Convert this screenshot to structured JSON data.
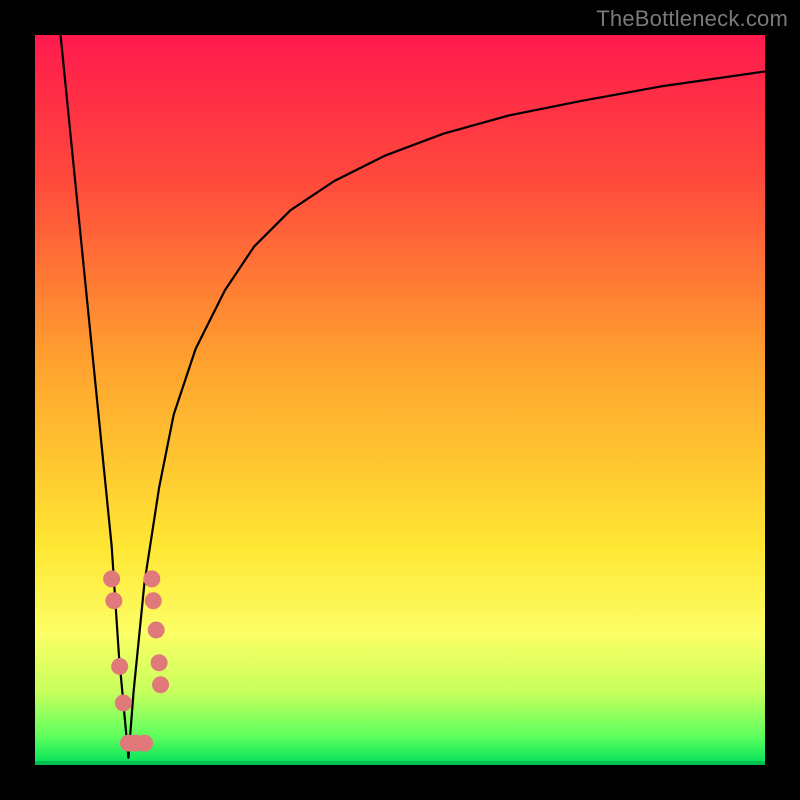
{
  "watermark": "TheBottleneck.com",
  "chart_data": {
    "type": "line",
    "title": "",
    "xlabel": "",
    "ylabel": "",
    "xlim": [
      0,
      100
    ],
    "ylim": [
      0,
      100
    ],
    "grid": false,
    "legend": false,
    "background_gradient_stops": [
      {
        "offset": 0.0,
        "color": "#ff1a4d"
      },
      {
        "offset": 0.2,
        "color": "#ff4a3c"
      },
      {
        "offset": 0.45,
        "color": "#ffa22e"
      },
      {
        "offset": 0.7,
        "color": "#ffe633"
      },
      {
        "offset": 0.82,
        "color": "#fcff66"
      },
      {
        "offset": 0.9,
        "color": "#c7ff5c"
      },
      {
        "offset": 0.96,
        "color": "#5eff5e"
      },
      {
        "offset": 1.0,
        "color": "#00e05a"
      }
    ],
    "series": [
      {
        "name": "left-branch",
        "color": "#000000",
        "x": [
          3.5,
          4.5,
          5.5,
          6.5,
          7.5,
          8.5,
          9.5,
          10.5,
          11.5,
          12.8
        ],
        "y": [
          100,
          90,
          80,
          70,
          60,
          50,
          40,
          30,
          15,
          1
        ]
      },
      {
        "name": "right-branch",
        "color": "#000000",
        "x": [
          12.8,
          13.5,
          15,
          17,
          19,
          22,
          26,
          30,
          35,
          41,
          48,
          56,
          65,
          75,
          86,
          100
        ],
        "y": [
          1,
          10,
          25,
          38,
          48,
          57,
          65,
          71,
          76,
          80,
          83.5,
          86.5,
          89,
          91,
          93,
          95
        ]
      }
    ],
    "scatter_points": {
      "name": "data-points",
      "color": "#e07a7a",
      "radius": 8.5,
      "points": [
        {
          "x": 10.5,
          "y": 25.5
        },
        {
          "x": 10.8,
          "y": 22.5
        },
        {
          "x": 11.6,
          "y": 13.5
        },
        {
          "x": 12.1,
          "y": 8.5
        },
        {
          "x": 12.8,
          "y": 3.0
        },
        {
          "x": 13.8,
          "y": 3.0
        },
        {
          "x": 15.0,
          "y": 3.0
        },
        {
          "x": 16.0,
          "y": 25.5
        },
        {
          "x": 16.2,
          "y": 22.5
        },
        {
          "x": 16.6,
          "y": 18.5
        },
        {
          "x": 17.0,
          "y": 14.0
        },
        {
          "x": 17.2,
          "y": 11.0
        }
      ]
    }
  }
}
